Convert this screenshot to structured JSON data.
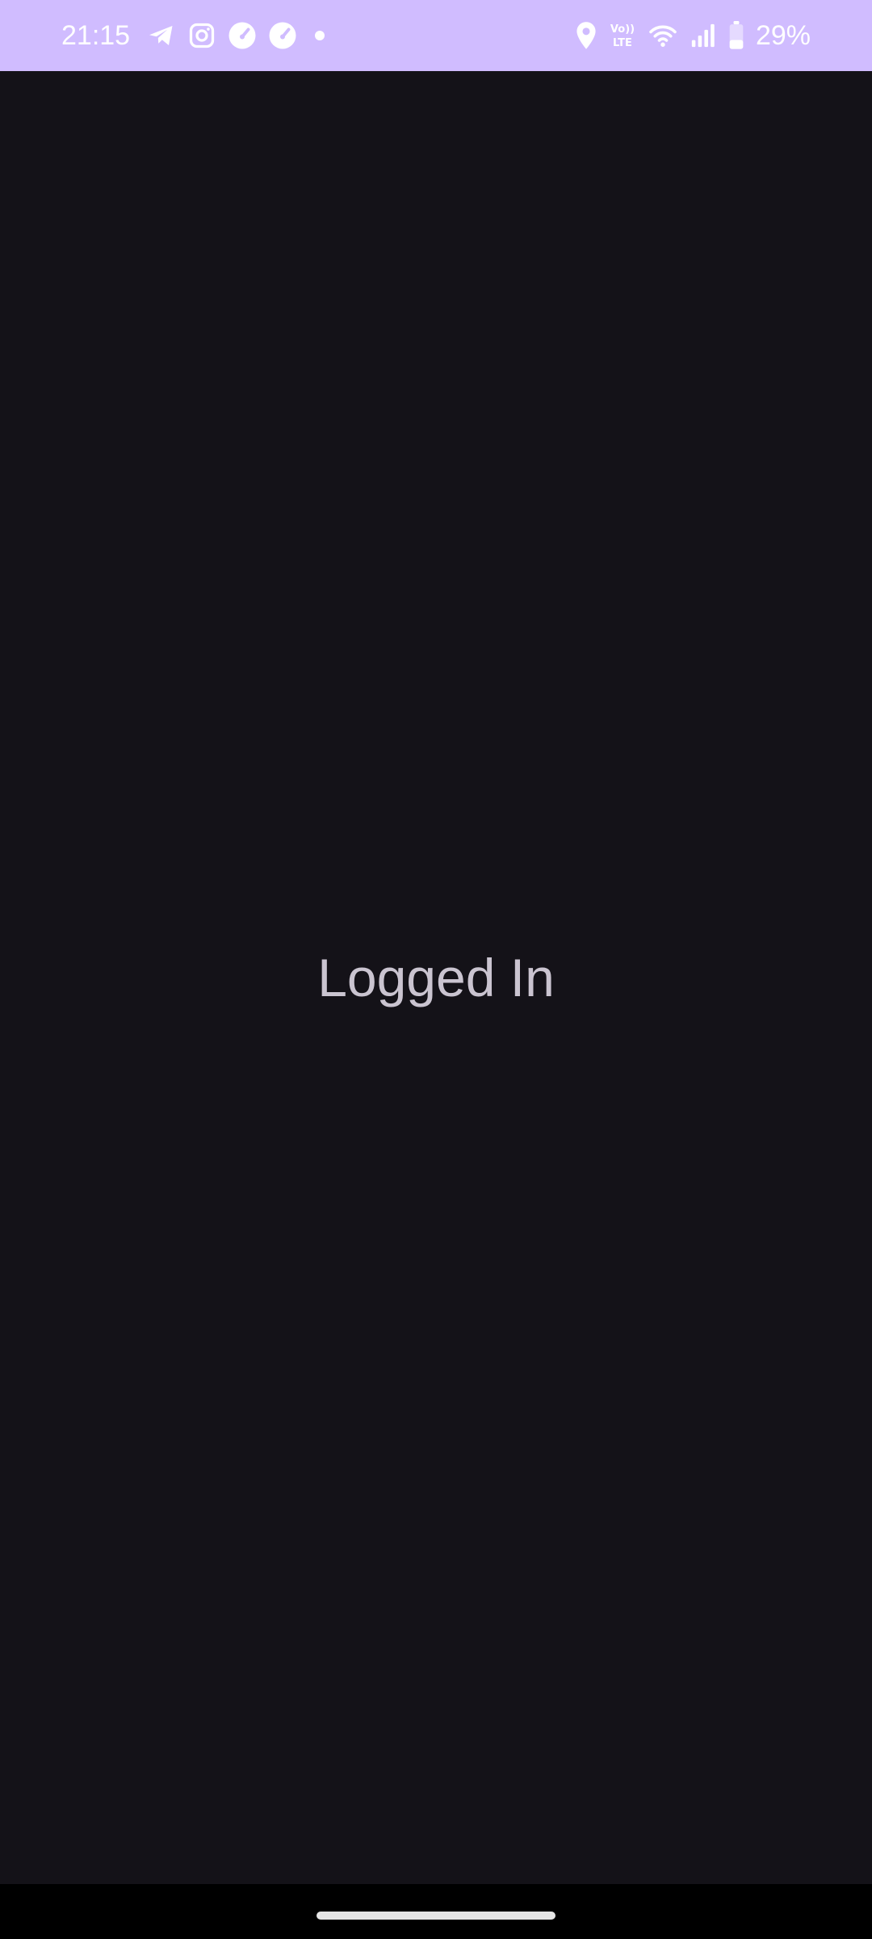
{
  "status_bar": {
    "time": "21:15",
    "battery_percent": "29%",
    "background_color": "#d0bcff",
    "icons_left": [
      "telegram-icon",
      "instagram-icon",
      "speedometer-icon",
      "speedometer-icon",
      "notification-dot-icon"
    ],
    "icons_right": [
      "location-icon",
      "volte-icon",
      "wifi-icon",
      "signal-icon",
      "battery-icon"
    ]
  },
  "main": {
    "message": "Logged In",
    "background_color": "#141218",
    "text_color": "#cac4d0"
  }
}
